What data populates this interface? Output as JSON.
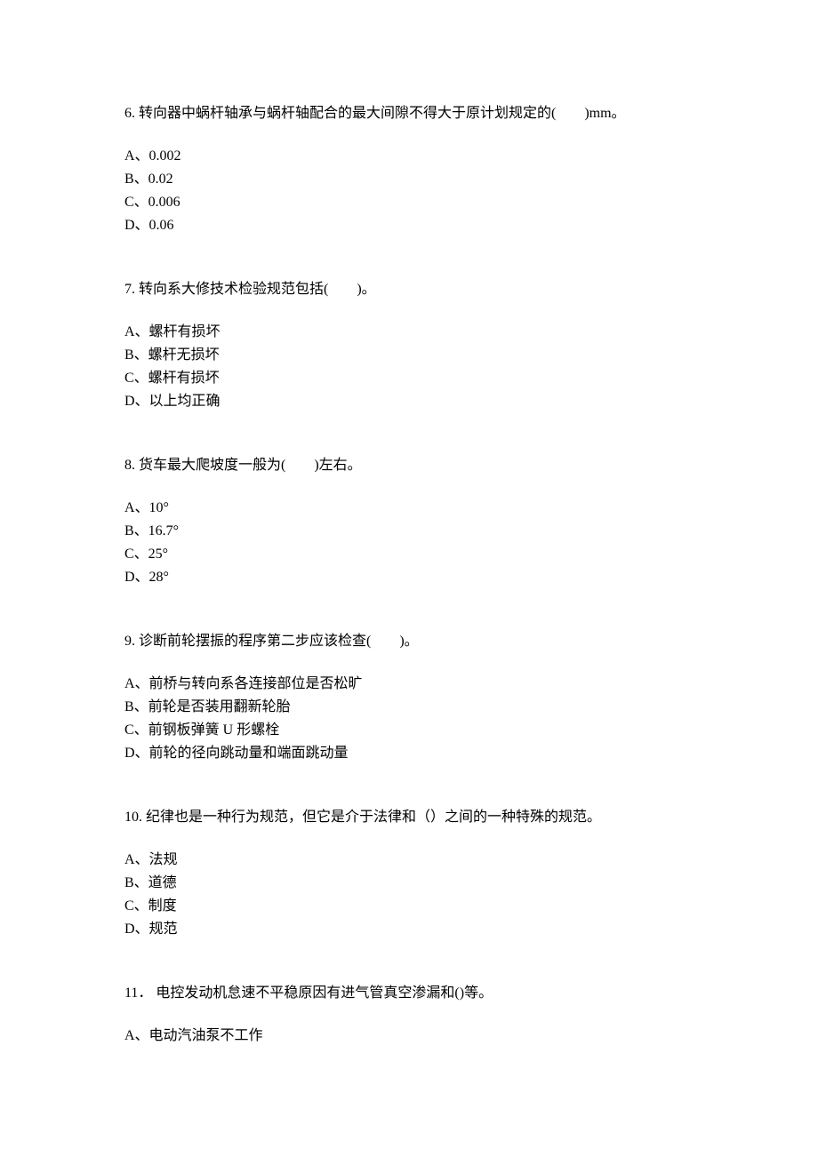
{
  "questions": [
    {
      "number": "6.",
      "text": "转向器中蜗杆轴承与蜗杆轴配合的最大间隙不得大于原计划规定的(  )mm。",
      "options": [
        "A、0.002",
        "B、0.02",
        "C、0.006",
        "D、0.06"
      ]
    },
    {
      "number": "7.",
      "text": "转向系大修技术检验规范包括(  )。",
      "options": [
        "A、螺杆有损坏",
        "B、螺杆无损坏",
        "C、螺杆有损坏",
        "D、以上均正确"
      ]
    },
    {
      "number": "8.",
      "text": "货车最大爬坡度一般为(  )左右。",
      "options": [
        "A、10°",
        "B、16.7°",
        "C、25°",
        "D、28°"
      ]
    },
    {
      "number": "9.",
      "text": "诊断前轮摆振的程序第二步应该检查(  )。",
      "options": [
        "A、前桥与转向系各连接部位是否松旷",
        "B、前轮是否装用翻新轮胎",
        "C、前钢板弹簧 U 形螺栓",
        "D、前轮的径向跳动量和端面跳动量"
      ]
    },
    {
      "number": "10.",
      "text": "纪律也是一种行为规范，但它是介于法律和（）之间的一种特殊的规范。",
      "options": [
        "A、法规",
        "B、道德",
        "C、制度",
        "D、规范"
      ]
    },
    {
      "number": "11．",
      "text": "电控发动机怠速不平稳原因有进气管真空渗漏和()等。",
      "options": [
        "A、电动汽油泵不工作"
      ]
    }
  ]
}
